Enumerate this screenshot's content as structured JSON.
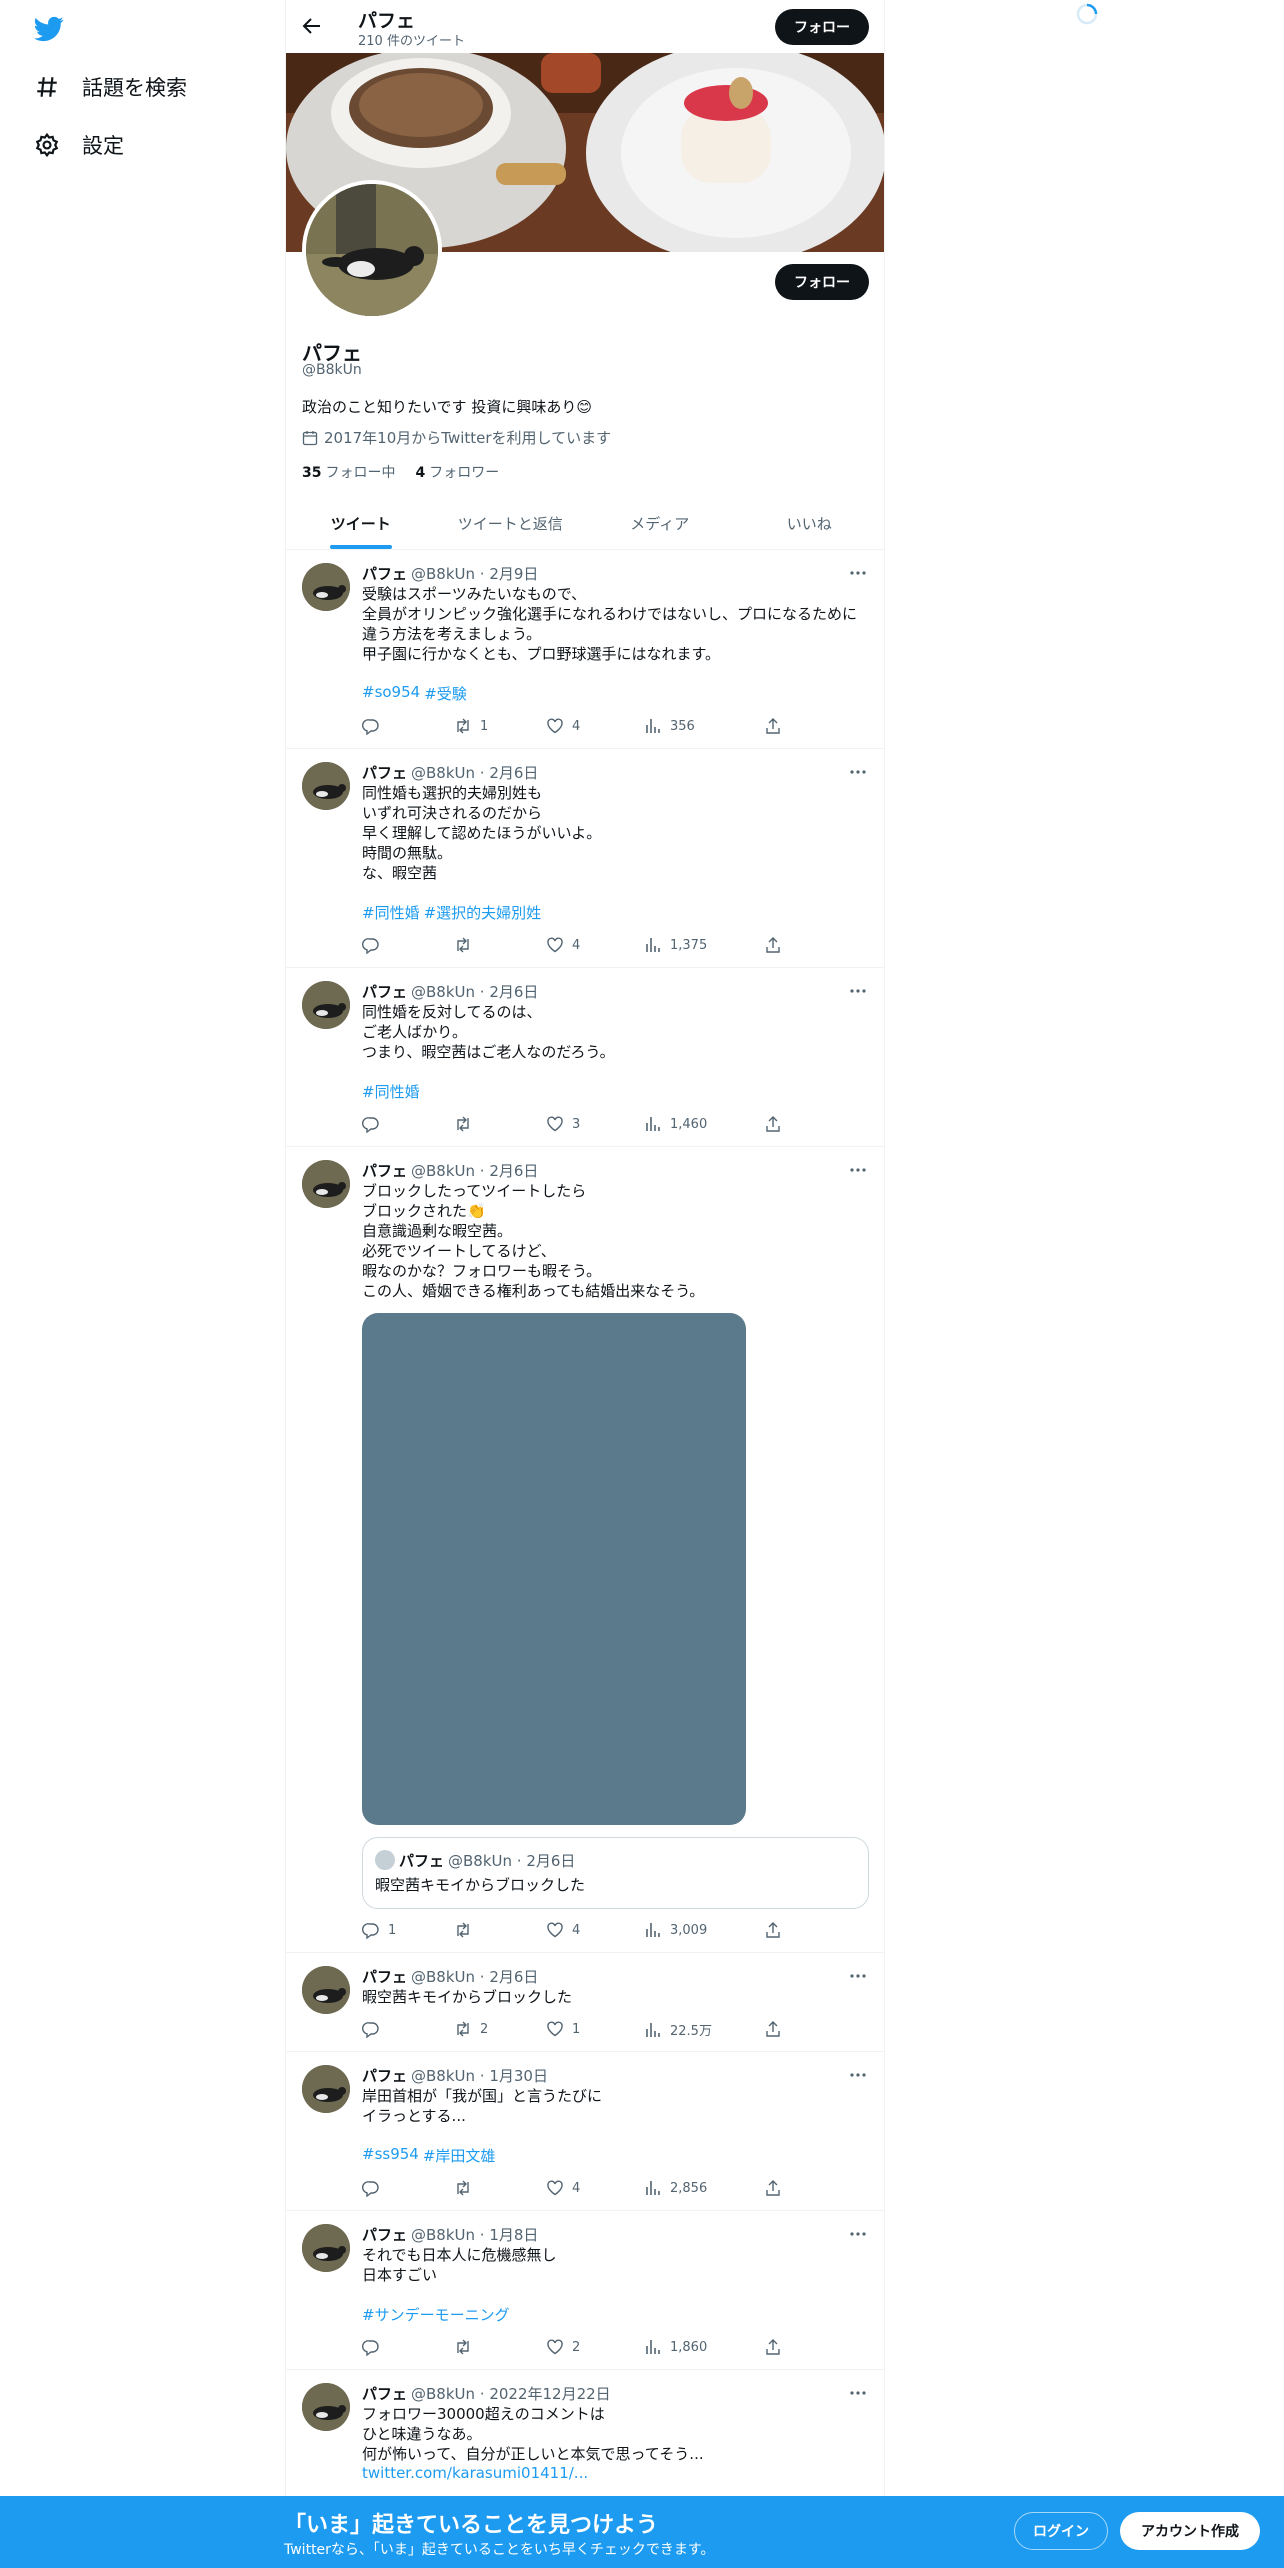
{
  "nav": {
    "items": [
      {
        "label": "話題を検索",
        "icon": "hashtag-icon"
      },
      {
        "label": "設定",
        "icon": "gear-icon"
      }
    ]
  },
  "header": {
    "name": "パフェ",
    "tweet_count": "210 件のツイート",
    "follow_label": "フォロー"
  },
  "profile": {
    "name": "パフェ",
    "handle": "@B8kUn",
    "bio": "政治のこと知りたいです 投資に興味あり😊",
    "joined": "2017年10月からTwitterを利用しています",
    "following_count": "35",
    "following_label": "フォロー中",
    "followers_count": "4",
    "followers_label": "フォロワー",
    "follow_label": "フォロー"
  },
  "tabs": [
    {
      "label": "ツイート"
    },
    {
      "label": "ツイートと返信"
    },
    {
      "label": "メディア"
    },
    {
      "label": "いいね"
    }
  ],
  "tweets": [
    {
      "name": "パフェ",
      "meta": "@B8kUn · 2月9日",
      "lines": [
        "受験はスポーツみたいなもので、",
        "全員がオリンピック強化選手になれるわけではないし、プロになるために",
        "違う方法を考えましょう。",
        "甲子園に行かなくとも、プロ野球選手にはなれます。"
      ],
      "tags": [
        "#so954",
        "#受験"
      ],
      "replies": "",
      "retweets": "1",
      "likes": "4",
      "views": "356"
    },
    {
      "name": "パフェ",
      "meta": "@B8kUn · 2月6日",
      "lines": [
        "同性婚も選択的夫婦別姓も",
        "いずれ可決されるのだから",
        "早く理解して認めたほうがいいよ。",
        "時間の無駄。",
        "な、暇空茜"
      ],
      "tags": [
        "#同性婚",
        "#選択的夫婦別姓"
      ],
      "replies": "",
      "retweets": "",
      "likes": "4",
      "views": "1,375"
    },
    {
      "name": "パフェ",
      "meta": "@B8kUn · 2月6日",
      "lines": [
        "同性婚を反対してるのは、",
        "ご老人ばかり。",
        "つまり、暇空茜はご老人なのだろう。"
      ],
      "tags": [
        "#同性婚"
      ],
      "replies": "",
      "retweets": "",
      "likes": "3",
      "views": "1,460"
    },
    {
      "name": "パフェ",
      "meta": "@B8kUn · 2月6日",
      "lines": [
        "ブロックしたってツイートしたら",
        "ブロックされた👏",
        "自意識過剰な暇空茜。",
        "必死でツイートしてるけど、",
        "暇なのかな？フォロワーも暇そう。",
        "この人、婚姻できる権利あっても結婚出来なそう。"
      ],
      "quote": {
        "name": "パフェ",
        "meta": "@B8kUn · 2月6日",
        "text": "暇空茜キモイからブロックした"
      },
      "replies": "1",
      "retweets": "",
      "likes": "4",
      "views": "3,009"
    },
    {
      "name": "パフェ",
      "meta": "@B8kUn · 2月6日",
      "lines": [
        "暇空茜キモイからブロックした"
      ],
      "replies": "",
      "retweets": "2",
      "likes": "1",
      "views": "22.5万"
    },
    {
      "name": "パフェ",
      "meta": "@B8kUn · 1月30日",
      "lines": [
        "岸田首相が「我が国」と言うたびに",
        "イラっとする..."
      ],
      "tags": [
        "#ss954",
        "#岸田文雄"
      ],
      "replies": "",
      "retweets": "",
      "likes": "4",
      "views": "2,856"
    },
    {
      "name": "パフェ",
      "meta": "@B8kUn · 1月8日",
      "lines": [
        "それでも日本人に危機感無し",
        "日本すごい"
      ],
      "tags": [
        "#サンデーモーニング"
      ],
      "replies": "",
      "retweets": "",
      "likes": "2",
      "views": "1,860"
    },
    {
      "name": "パフェ",
      "meta": "@B8kUn · 2022年12月22日",
      "lines": [
        "フォロワー30000超えのコメントは",
        "ひと味違うなあ。",
        "何が怖いって、自分が正しいと本気で思ってそう..."
      ],
      "link": "twitter.com/karasumi01411/..."
    }
  ],
  "bottom_bar": {
    "title": "「いま」起きていることを見つけよう",
    "subtitle": "Twitterなら、「いま」起きていることをいち早くチェックできます。",
    "login_label": "ログイン",
    "signup_label": "アカウント作成"
  },
  "colors": {
    "accent": "#1d9bf0",
    "text": "#0f1419",
    "muted": "#536471"
  }
}
